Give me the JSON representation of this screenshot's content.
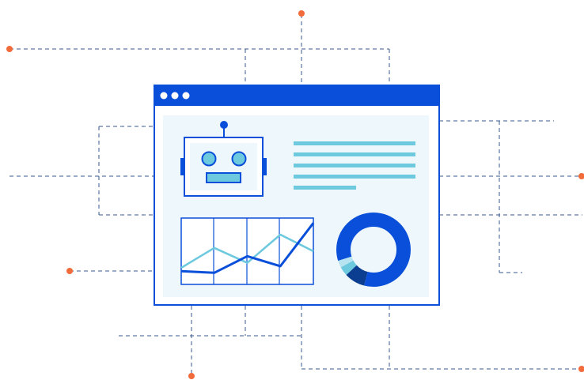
{
  "colors": {
    "primary": "#0a4fd9",
    "light_blue": "#6cc9de",
    "panel": "#eef7fb",
    "accent_dot": "#f26b3a",
    "dash_line": "#3a5a8c",
    "dark_blue": "#0b3d91",
    "pale_blue": "#b6e3ef"
  },
  "icons": [
    "window-dots-icon",
    "robot-icon",
    "line-chart-icon",
    "donut-chart-icon"
  ],
  "mini_chart": {
    "series": [
      {
        "values": [
          1,
          2.2,
          1.3,
          3.0,
          2.0
        ]
      },
      {
        "values": [
          0.8,
          0.7,
          1.7,
          1.1,
          3.7
        ]
      }
    ],
    "ylim": [
      0,
      4
    ]
  },
  "donut": {
    "segments": [
      {
        "value": 0.84
      },
      {
        "value": 0.09
      },
      {
        "value": 0.04
      },
      {
        "value": 0.03
      }
    ]
  }
}
